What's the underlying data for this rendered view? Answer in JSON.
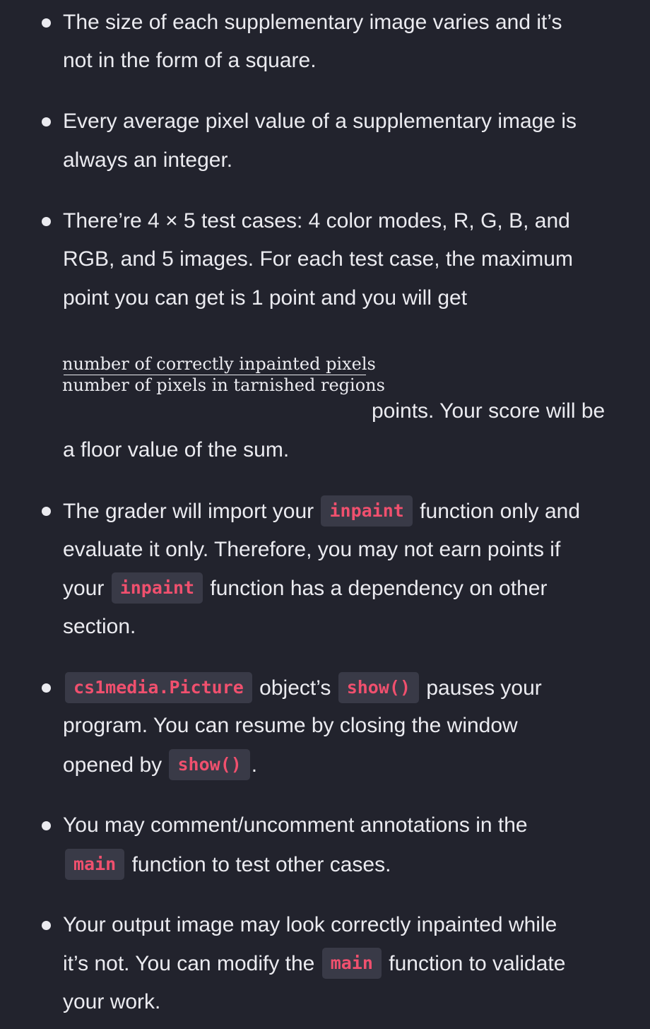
{
  "notes": [
    {
      "lines": [
        "The size of each supplementary image varies and it’s",
        "not in the form of a square."
      ]
    },
    {
      "lines": [
        "Every average pixel value of a supplementary image is",
        "always an integer."
      ]
    },
    {
      "lines": [
        "There’re 4 × 5 test cases: 4 color modes, R, G, B, and",
        "RGB, and 5 images. For each test case, the maximum",
        "point you can get is 1 point and you will get"
      ],
      "fraction": {
        "numerator": "number of correctly inpainted pixels",
        "denominator": "number of pixels in tarnished regions"
      },
      "after_fraction": "points. Your score will be",
      "last_line": "a floor value of the sum."
    },
    {
      "line1_before": "The grader will import your",
      "line1_code": "inpaint",
      "line1_after": "function only and",
      "line2": "evaluate it only. Therefore, you may not earn points if",
      "line3_before": "your",
      "line3_code": "inpaint",
      "line3_after": "function has a dependency on other",
      "line4": "section."
    },
    {
      "line1_code1": "cs1media.Picture",
      "line1_mid": "object’s",
      "line1_code2": "show()",
      "line1_after": "pauses your",
      "line2": "program. You can resume by closing the window",
      "line3_before": "opened by",
      "line3_code": "show()",
      "line3_after": "."
    },
    {
      "line1": "You may comment/uncomment annotations in the",
      "line2_code": "main",
      "line2_after": "function to test other cases."
    },
    {
      "line1": "Your output image may look correctly inpainted while",
      "line2_before": "it’s not. You can modify the",
      "line2_code": "main",
      "line2_after": "function to validate",
      "line3": "your work."
    }
  ]
}
